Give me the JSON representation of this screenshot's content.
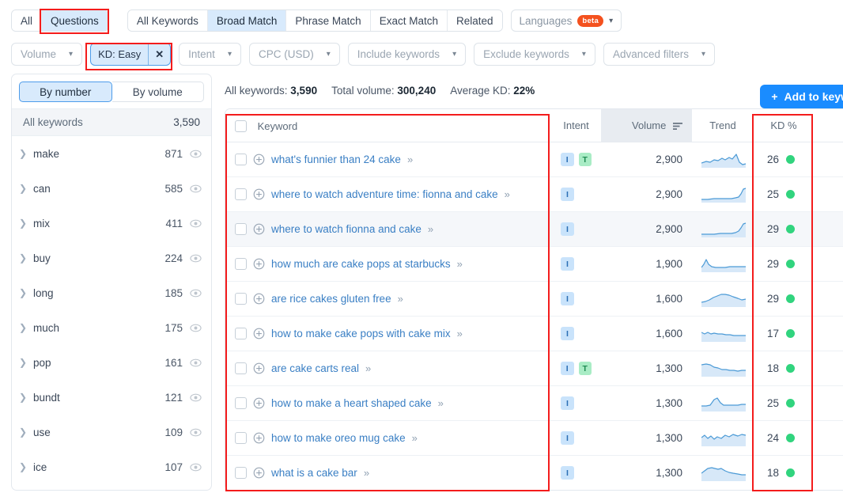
{
  "tabs_primary": [
    {
      "label": "All",
      "active": false
    },
    {
      "label": "Questions",
      "active": true
    }
  ],
  "tabs_match": [
    {
      "label": "All Keywords",
      "active": false
    },
    {
      "label": "Broad Match",
      "active": true
    },
    {
      "label": "Phrase Match",
      "active": false
    },
    {
      "label": "Exact Match",
      "active": false
    },
    {
      "label": "Related",
      "active": false
    }
  ],
  "languages": {
    "label": "Languages",
    "badge": "beta",
    "caret": "chevron-down-icon"
  },
  "filters": [
    {
      "label": "Volume",
      "type": "dropdown"
    },
    {
      "label": "KD: Easy",
      "type": "active",
      "close": "✕"
    },
    {
      "label": "Intent",
      "type": "dropdown"
    },
    {
      "label": "CPC (USD)",
      "type": "dropdown"
    },
    {
      "label": "Include keywords",
      "type": "dropdown"
    },
    {
      "label": "Exclude keywords",
      "type": "dropdown"
    },
    {
      "label": "Advanced filters",
      "type": "dropdown"
    }
  ],
  "sidebar": {
    "toggle": [
      {
        "label": "By number",
        "active": true
      },
      {
        "label": "By volume",
        "active": false
      }
    ],
    "all_label": "All keywords",
    "all_count": "3,590",
    "items": [
      {
        "label": "make",
        "count": "871"
      },
      {
        "label": "can",
        "count": "585"
      },
      {
        "label": "mix",
        "count": "411"
      },
      {
        "label": "buy",
        "count": "224"
      },
      {
        "label": "long",
        "count": "185"
      },
      {
        "label": "much",
        "count": "175"
      },
      {
        "label": "pop",
        "count": "161"
      },
      {
        "label": "bundt",
        "count": "121"
      },
      {
        "label": "use",
        "count": "109"
      },
      {
        "label": "ice",
        "count": "107"
      }
    ]
  },
  "stats": {
    "all_keywords_label": "All keywords:",
    "all_keywords_value": "3,590",
    "total_volume_label": "Total volume:",
    "total_volume_value": "300,240",
    "average_kd_label": "Average KD:",
    "average_kd_value": "22%"
  },
  "add_button": {
    "plus": "+",
    "label": "Add to keyw"
  },
  "table": {
    "columns": [
      "Keyword",
      "Intent",
      "Volume",
      "Trend",
      "KD %"
    ],
    "sort_column": "Volume",
    "sort_dir": "descending",
    "rows": [
      {
        "keyword": "what's funnier than 24 cake",
        "intent": [
          "I",
          "T"
        ],
        "volume": "2,900",
        "kd": "26",
        "kd_color": "#31d47e",
        "trend": "0,14 6,12 11,13 16,10 21,11 26,8 30,10 35,7 39,9 44,3 48,13 52,16 56,15"
      },
      {
        "keyword": "where to watch adventure time: fionna and cake",
        "intent": [
          "I"
        ],
        "volume": "2,900",
        "kd": "25",
        "kd_color": "#31d47e",
        "trend": "0,16 8,16 16,15 24,15 32,15 38,15 43,14 47,13 50,9 53,3 56,2"
      },
      {
        "keyword": "where to watch fionna and cake",
        "intent": [
          "I"
        ],
        "volume": "2,900",
        "kd": "29",
        "kd_color": "#31d47e",
        "trend": "0,16 8,16 16,16 24,15 32,15 38,15 43,14 47,12 50,8 53,3 56,2"
      },
      {
        "keyword": "how much are cake pops at starbucks",
        "intent": [
          "I"
        ],
        "volume": "1,900",
        "kd": "29",
        "kd_color": "#31d47e",
        "trend": "0,14 3,10 6,4 9,10 13,13 18,14 24,14 30,14 36,13 42,13 48,13 56,13"
      },
      {
        "keyword": "are rice cakes gluten free",
        "intent": [
          "I"
        ],
        "volume": "1,600",
        "kd": "29",
        "kd_color": "#31d47e",
        "trend": "0,14 5,13 10,11 15,8 20,6 25,4 30,4 35,5 40,7 46,9 51,11 56,10"
      },
      {
        "keyword": "how to make cake pops with cake mix",
        "intent": [
          "I"
        ],
        "volume": "1,600",
        "kd": "17",
        "kd_color": "#31d47e",
        "trend": "0,8 4,10 8,8 12,10 16,9 21,10 26,10 31,11 36,11 41,12 46,12 51,12 56,12"
      },
      {
        "keyword": "are cake carts real",
        "intent": [
          "I",
          "T"
        ],
        "volume": "1,300",
        "kd": "18",
        "kd_color": "#31d47e",
        "trend": "0,5 6,4 11,5 16,8 21,9 26,11 31,11 36,12 41,12 46,13 51,12 56,12"
      },
      {
        "keyword": "how to make a heart shaped cake",
        "intent": [
          "I"
        ],
        "volume": "1,300",
        "kd": "25",
        "kd_color": "#31d47e",
        "trend": "0,13 6,13 11,12 16,5 20,3 24,9 28,12 34,12 40,12 46,12 51,11 56,11"
      },
      {
        "keyword": "how to make oreo mug cake",
        "intent": [
          "I"
        ],
        "volume": "1,300",
        "kd": "24",
        "kd_color": "#31d47e",
        "trend": "0,9 4,6 8,10 12,7 16,11 20,8 25,10 30,6 35,8 40,5 46,7 51,5 56,6"
      },
      {
        "keyword": "what is a cake bar",
        "intent": [
          "I"
        ],
        "volume": "1,300",
        "kd": "18",
        "kd_color": "#31d47e",
        "trend": "0,10 4,7 8,4 13,3 17,4 21,5 25,4 30,7 35,9 40,10 46,11 51,12 56,12"
      }
    ]
  },
  "colors": {
    "accent_blue": "#1a8cff",
    "link_blue": "#3a7fc4",
    "selected_bg": "#d8eafc",
    "kd_green": "#31d47e",
    "beta_orange": "#f4511e",
    "annotation_red": "#f41c1c"
  }
}
